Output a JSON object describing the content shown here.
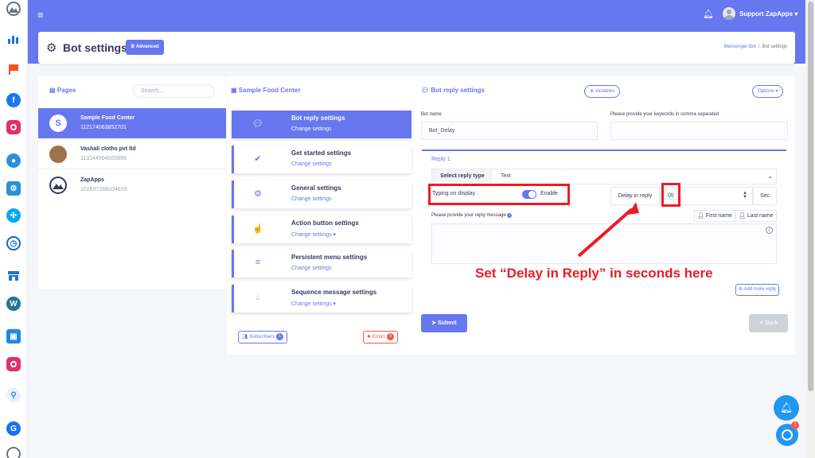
{
  "topbar": {
    "menu_icon": "hamburger-icon",
    "notification_icon": "bell-icon",
    "username": "Support ZapApps"
  },
  "leftbar": {
    "icons": [
      {
        "name": "logo-icon",
        "color": "#6c757d"
      },
      {
        "name": "analytics-icon",
        "color": "#1976d2"
      },
      {
        "name": "flag-icon",
        "color": "#f4511e"
      },
      {
        "name": "facebook-icon",
        "color": "#1877f2"
      },
      {
        "name": "instagram-icon",
        "color": "#e1306c"
      },
      {
        "name": "users-icon",
        "color": "#2b90d9"
      },
      {
        "name": "settings-icon",
        "color": "#2b90d9"
      },
      {
        "name": "network-icon",
        "color": "#03a9f4"
      },
      {
        "name": "clock-icon",
        "color": "#1565c0"
      },
      {
        "name": "store-icon",
        "color": "#1976d2"
      },
      {
        "name": "wordpress-icon",
        "color": "#21759b"
      },
      {
        "name": "image-icon",
        "color": "#1e88e5"
      },
      {
        "name": "instagram-icon-2",
        "color": "#e1306c"
      },
      {
        "name": "search-icon",
        "color": "#1e88e5"
      },
      {
        "name": "google-icon",
        "color": "#1a73e8"
      },
      {
        "name": "mountain-icon",
        "color": "#6c757d"
      }
    ]
  },
  "header": {
    "title": "Bot settings",
    "advanced_label": "Advanced",
    "breadcrumb": [
      "Messenger Bot",
      "Bot settings"
    ]
  },
  "pages_panel": {
    "title": "Pages",
    "search_placeholder": "Search...",
    "items": [
      {
        "name": "Sample Food Center",
        "id": "112174063852701",
        "avatar_letter": "S"
      },
      {
        "name": "Vashali cloths pvt ltd",
        "id": "113144504005699",
        "avatar_letter": ""
      },
      {
        "name": "ZapApps",
        "id": "101697268104633",
        "avatar_letter": ""
      }
    ]
  },
  "menu_panel": {
    "title": "Sample Food Center",
    "items": [
      {
        "title": "Bot reply settings",
        "sub": "Change settings"
      },
      {
        "title": "Get started settings",
        "sub": "Change settings"
      },
      {
        "title": "General settings",
        "sub": "Change settings"
      },
      {
        "title": "Action button settings",
        "sub": "Change settings"
      },
      {
        "title": "Persistent menu settings",
        "sub": "Change settings"
      },
      {
        "title": "Sequence message settings",
        "sub": "Change settings"
      }
    ],
    "subscribers_label": "Subscribers",
    "subscribers_count": "1",
    "errors_label": "Errors",
    "errors_count": "0"
  },
  "reply_panel": {
    "title": "Bot reply settings",
    "variables_label": "Variables",
    "options_label": "Options",
    "bot_name_label": "Bot name",
    "bot_name_value": "Bot_Delay",
    "keywords_label": "Please provide your keywords in comma separated",
    "keywords_value": "",
    "reply_title": "Reply 1",
    "select_reply_type_label": "Select reply type",
    "reply_type_value": "Text",
    "typing_label": "Typing on display :",
    "enable_label": "Enable",
    "delay_label": "Delay in reply",
    "delay_value": "05",
    "sec_label": "Sec",
    "message_label": "Please provide your reply message",
    "first_name_label": "First name",
    "last_name_label": "Last name",
    "add_more_label": "Add more reply",
    "submit_label": "Submit",
    "back_label": "Back"
  },
  "annotation": {
    "callout": "Set “Delay in Reply” in seconds here",
    "color": "#ee1b24"
  },
  "colors": {
    "primary": "#6777ef",
    "danger": "#fc544b",
    "chat": "#2196f3"
  },
  "chat_badge": "1"
}
